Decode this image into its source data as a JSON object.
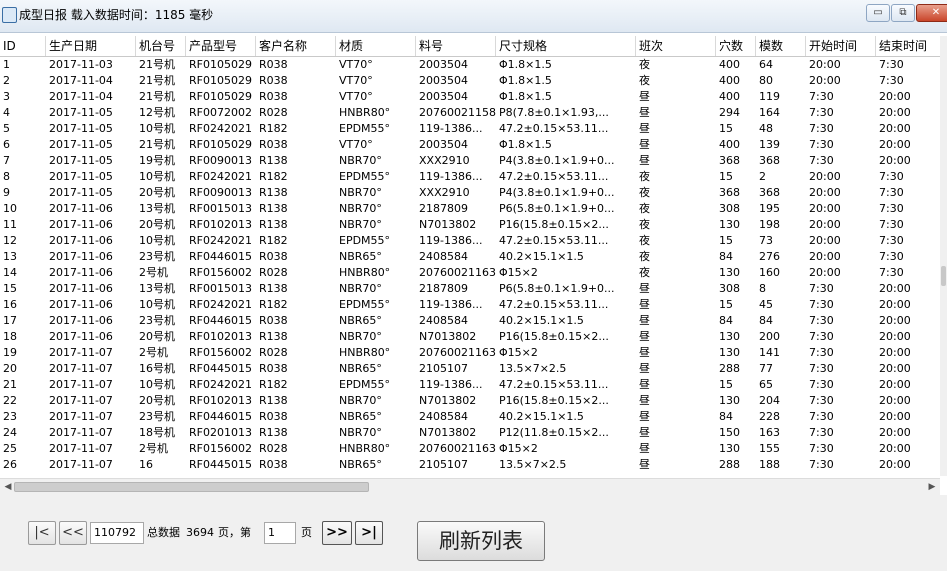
{
  "window": {
    "title": "成型日报 载入数据时间：1185 毫秒",
    "minimize_label": "▭",
    "maximize_label": "⧉",
    "close_label": "✕"
  },
  "columns": [
    "ID",
    "生产日期",
    "机台号",
    "产品型号",
    "客户名称",
    "材质",
    "料号",
    "尺寸规格",
    "班次",
    "穴数",
    "模数",
    "开始时间",
    "结束时间"
  ],
  "rows": [
    [
      "1",
      "2017-11-03",
      "21号机",
      "RF0105029",
      "R038",
      "VT70°",
      "2003504",
      "Φ1.8×1.5",
      "夜",
      "400",
      "64",
      "20:00",
      "7:30"
    ],
    [
      "2",
      "2017-11-04",
      "21号机",
      "RF0105029",
      "R038",
      "VT70°",
      "2003504",
      "Φ1.8×1.5",
      "夜",
      "400",
      "80",
      "20:00",
      "7:30"
    ],
    [
      "3",
      "2017-11-04",
      "21号机",
      "RF0105029",
      "R038",
      "VT70°",
      "2003504",
      "Φ1.8×1.5",
      "昼",
      "400",
      "119",
      "7:30",
      "20:00"
    ],
    [
      "4",
      "2017-11-05",
      "12号机",
      "RF0072002",
      "R028",
      "HNBR80°",
      "20760021158",
      "P8(7.8±0.1×1.93,...",
      "昼",
      "294",
      "164",
      "7:30",
      "20:00"
    ],
    [
      "5",
      "2017-11-05",
      "10号机",
      "RF0242021",
      "R182",
      "EPDM55°",
      "119-1386...",
      "47.2±0.15×53.11...",
      "昼",
      "15",
      "48",
      "7:30",
      "20:00"
    ],
    [
      "6",
      "2017-11-05",
      "21号机",
      "RF0105029",
      "R038",
      "VT70°",
      "2003504",
      "Φ1.8×1.5",
      "昼",
      "400",
      "139",
      "7:30",
      "20:00"
    ],
    [
      "7",
      "2017-11-05",
      "19号机",
      "RF0090013",
      "R138",
      "NBR70°",
      "XXX2910",
      "P4(3.8±0.1×1.9+0...",
      "昼",
      "368",
      "368",
      "7:30",
      "20:00"
    ],
    [
      "8",
      "2017-11-05",
      "10号机",
      "RF0242021",
      "R182",
      "EPDM55°",
      "119-1386...",
      "47.2±0.15×53.11...",
      "夜",
      "15",
      "2",
      "20:00",
      "7:30"
    ],
    [
      "9",
      "2017-11-05",
      "20号机",
      "RF0090013",
      "R138",
      "NBR70°",
      "XXX2910",
      "P4(3.8±0.1×1.9+0...",
      "夜",
      "368",
      "368",
      "20:00",
      "7:30"
    ],
    [
      "10",
      "2017-11-06",
      "13号机",
      "RF0015013",
      "R138",
      "NBR70°",
      "2187809",
      "P6(5.8±0.1×1.9+0...",
      "夜",
      "308",
      "195",
      "20:00",
      "7:30"
    ],
    [
      "11",
      "2017-11-06",
      "20号机",
      "RF0102013",
      "R138",
      "NBR70°",
      "N7013802",
      "P16(15.8±0.15×2...",
      "夜",
      "130",
      "198",
      "20:00",
      "7:30"
    ],
    [
      "12",
      "2017-11-06",
      "10号机",
      "RF0242021",
      "R182",
      "EPDM55°",
      "119-1386...",
      "47.2±0.15×53.11...",
      "夜",
      "15",
      "73",
      "20:00",
      "7:30"
    ],
    [
      "13",
      "2017-11-06",
      "23号机",
      "RF0446015",
      "R038",
      "NBR65°",
      "2408584",
      "40.2×15.1×1.5",
      "夜",
      "84",
      "276",
      "20:00",
      "7:30"
    ],
    [
      "14",
      "2017-11-06",
      "2号机",
      "RF0156002",
      "R028",
      "HNBR80°",
      "20760021163",
      "Φ15×2",
      "夜",
      "130",
      "160",
      "20:00",
      "7:30"
    ],
    [
      "15",
      "2017-11-06",
      "13号机",
      "RF0015013",
      "R138",
      "NBR70°",
      "2187809",
      "P6(5.8±0.1×1.9+0...",
      "昼",
      "308",
      "8",
      "7:30",
      "20:00"
    ],
    [
      "16",
      "2017-11-06",
      "10号机",
      "RF0242021",
      "R182",
      "EPDM55°",
      "119-1386...",
      "47.2±0.15×53.11...",
      "昼",
      "15",
      "45",
      "7:30",
      "20:00"
    ],
    [
      "17",
      "2017-11-06",
      "23号机",
      "RF0446015",
      "R038",
      "NBR65°",
      "2408584",
      "40.2×15.1×1.5",
      "昼",
      "84",
      "84",
      "7:30",
      "20:00"
    ],
    [
      "18",
      "2017-11-06",
      "20号机",
      "RF0102013",
      "R138",
      "NBR70°",
      "N7013802",
      "P16(15.8±0.15×2...",
      "昼",
      "130",
      "200",
      "7:30",
      "20:00"
    ],
    [
      "19",
      "2017-11-07",
      "2号机",
      "RF0156002",
      "R028",
      "HNBR80°",
      "20760021163",
      "Φ15×2",
      "昼",
      "130",
      "141",
      "7:30",
      "20:00"
    ],
    [
      "20",
      "2017-11-07",
      "16号机",
      "RF0445015",
      "R038",
      "NBR65°",
      "2105107",
      "13.5×7×2.5",
      "昼",
      "288",
      "77",
      "7:30",
      "20:00"
    ],
    [
      "21",
      "2017-11-07",
      "10号机",
      "RF0242021",
      "R182",
      "EPDM55°",
      "119-1386...",
      "47.2±0.15×53.11...",
      "昼",
      "15",
      "65",
      "7:30",
      "20:00"
    ],
    [
      "22",
      "2017-11-07",
      "20号机",
      "RF0102013",
      "R138",
      "NBR70°",
      "N7013802",
      "P16(15.8±0.15×2...",
      "昼",
      "130",
      "204",
      "7:30",
      "20:00"
    ],
    [
      "23",
      "2017-11-07",
      "23号机",
      "RF0446015",
      "R038",
      "NBR65°",
      "2408584",
      "40.2×15.1×1.5",
      "昼",
      "84",
      "228",
      "7:30",
      "20:00"
    ],
    [
      "24",
      "2017-11-07",
      "18号机",
      "RF0201013",
      "R138",
      "NBR70°",
      "N7013802",
      "P12(11.8±0.15×2...",
      "昼",
      "150",
      "163",
      "7:30",
      "20:00"
    ],
    [
      "25",
      "2017-11-07",
      "2号机",
      "RF0156002",
      "R028",
      "HNBR80°",
      "20760021163",
      "Φ15×2",
      "昼",
      "130",
      "155",
      "7:30",
      "20:00"
    ],
    [
      "26",
      "2017-11-07",
      "16",
      "RF0445015",
      "R038",
      "NBR65°",
      "2105107",
      "13.5×7×2.5",
      "昼",
      "288",
      "188",
      "7:30",
      "20:00"
    ]
  ],
  "pager": {
    "first_label": "|<",
    "prev_label": "<<",
    "current_value": "110792",
    "total_label": "总数据",
    "total_count": "3694",
    "pages_label": "页，第",
    "page_input": "1",
    "page_suffix": "页",
    "next_label": ">>",
    "last_label": ">|",
    "refresh_label": "刷新列表"
  },
  "scrollbar": {
    "left_arrow": "◀",
    "right_arrow": "▶"
  }
}
